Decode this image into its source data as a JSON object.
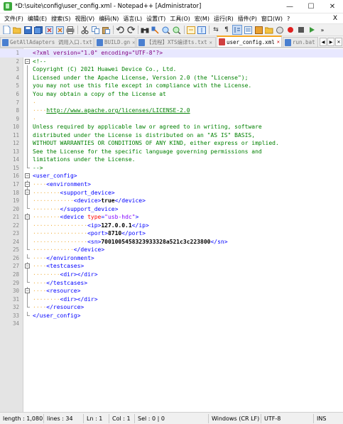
{
  "window": {
    "title": "*D:\\suite\\config\\user_config.xml - Notepad++ [Administrator]",
    "minimize": "—",
    "maximize": "☐",
    "close": "✕"
  },
  "menu": {
    "items": [
      "文件(F)",
      "编辑(E)",
      "搜索(S)",
      "视图(V)",
      "编码(N)",
      "语言(L)",
      "设置(T)",
      "工具(O)",
      "宏(M)",
      "运行(R)",
      "插件(P)",
      "窗口(W)",
      "?"
    ],
    "close_doc": "X"
  },
  "toolbar": {
    "icons": [
      "new-file-icon",
      "open-file-icon",
      "save-icon",
      "save-all-icon",
      "close-icon",
      "close-all-icon",
      "print-icon",
      "cut-icon",
      "copy-icon",
      "paste-icon",
      "undo-icon",
      "redo-icon",
      "find-icon",
      "replace-icon",
      "zoom-in-icon",
      "zoom-out-icon",
      "sync-v-icon",
      "sync-h-icon",
      "word-wrap-icon",
      "show-all-icon",
      "indent-guide-icon",
      "function-list-icon",
      "doc-map-icon",
      "folder-icon",
      "monitor-icon",
      "record-icon",
      "stop-icon",
      "play-icon",
      "more-icon"
    ]
  },
  "tabs": [
    {
      "label": "GetAllAdapters 调用入口.txt",
      "color": "#4a7fd0",
      "active": false
    },
    {
      "label": "BUILD.gn",
      "color": "#4a7fd0",
      "active": false
    },
    {
      "label": "【流程】XTS编译ts.txt",
      "color": "#4a7fd0",
      "active": false
    },
    {
      "label": "user_config.xml",
      "color": "#d04040",
      "active": true
    },
    {
      "label": "run.bat",
      "color": "#4a7fd0",
      "active": false
    }
  ],
  "editor": {
    "lines": [
      {
        "n": "1"
      },
      {
        "n": "2"
      },
      {
        "n": "3"
      },
      {
        "n": "4"
      },
      {
        "n": "5"
      },
      {
        "n": "6"
      },
      {
        "n": "7"
      },
      {
        "n": "8"
      },
      {
        "n": "9"
      },
      {
        "n": "10"
      },
      {
        "n": "11"
      },
      {
        "n": "12"
      },
      {
        "n": "13"
      },
      {
        "n": "14"
      },
      {
        "n": "15"
      },
      {
        "n": "16"
      },
      {
        "n": "17"
      },
      {
        "n": "18"
      },
      {
        "n": "19"
      },
      {
        "n": "20"
      },
      {
        "n": "21"
      },
      {
        "n": "22"
      },
      {
        "n": "23"
      },
      {
        "n": "24"
      },
      {
        "n": "25"
      },
      {
        "n": "26"
      },
      {
        "n": "27"
      },
      {
        "n": "28"
      },
      {
        "n": "29"
      },
      {
        "n": "30"
      },
      {
        "n": "31"
      },
      {
        "n": "32"
      },
      {
        "n": "33"
      },
      {
        "n": "34"
      }
    ],
    "xml_decl": "<?xml version=\"1.0\" encoding=\"UTF-8\"?>",
    "comment_open": "<!--",
    "copyright": "Copyright (C) 2021 Huawei Device Co., Ltd.",
    "license1": "Licensed under the Apache License, Version 2.0 (the \"License\");",
    "license2": "you may not use this file except in compliance with the License.",
    "license3": "You may obtain a copy of the License at",
    "license_url": "http://www.apache.org/licenses/LICENSE-2.0",
    "license4": "Unless required by applicable law or agreed to in writing, software",
    "license5": "distributed under the License is distributed on an \"AS IS\" BASIS,",
    "license6": "WITHOUT WARRANTIES OR CONDITIONS OF ANY KIND, either express or implied.",
    "license7": "See the License for the specific language governing permissions and",
    "license8": "limitations under the License.",
    "comment_close": "-->",
    "user_config_open": "<user_config>",
    "environment_open": "<environment>",
    "support_device_open": "<support_device>",
    "device_tag_open": "<device>",
    "device_value": "true",
    "device_tag_close": "</device>",
    "support_device_close": "</support_device>",
    "device_type_tag": "<device",
    "device_type_attr": "type",
    "device_type_val": "\"usb-hdc\"",
    "device_type_end": ">",
    "ip_open": "<ip>",
    "ip_value": "127.0.0.1",
    "ip_close": "</ip>",
    "port_open": "<port>",
    "port_value": "8710",
    "port_close": "</port>",
    "sn_open": "<sn>",
    "sn_value": "7001005458323933328a521c3c223800",
    "sn_close": "</sn>",
    "device_close": "</device>",
    "environment_close": "</environment>",
    "testcases_open": "<testcases>",
    "dir_open": "<dir>",
    "dir_close": "</dir>",
    "testcases_close": "</testcases>",
    "resource_open": "<resource>",
    "resource_close": "</resource>",
    "user_config_close": "</user_config>"
  },
  "status": {
    "length": "length : 1,080",
    "lines": "lines : 34",
    "ln": "Ln : 1",
    "col": "Col : 1",
    "sel": "Sel : 0 | 0",
    "eol": "Windows (CR LF)",
    "encoding": "UTF-8",
    "mode": "INS"
  }
}
